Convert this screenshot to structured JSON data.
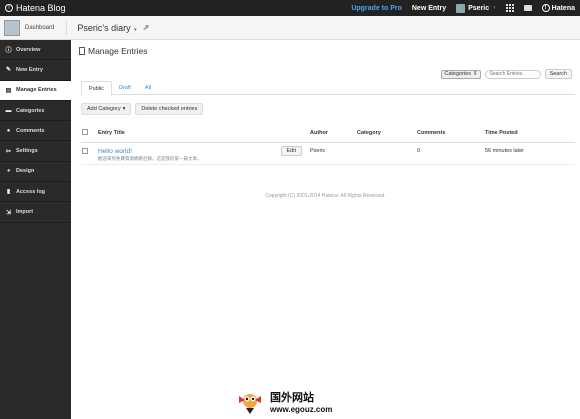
{
  "topbar": {
    "brand": "Hatena Blog",
    "upgrade": "Upgrade to Pro",
    "new_entry": "New Entry",
    "user": "Pseric",
    "brand_small": "Hatena"
  },
  "blogbar": {
    "dashboard": "Dashboard",
    "blog_name": "Pseric's diary"
  },
  "sidebar": {
    "items": [
      {
        "label": "Overview",
        "icon": "info-icon"
      },
      {
        "label": "New Entry",
        "icon": "pencil-icon"
      },
      {
        "label": "Manage Entries",
        "icon": "document-icon"
      },
      {
        "label": "Categories",
        "icon": "folder-icon"
      },
      {
        "label": "Comments",
        "icon": "comment-icon"
      },
      {
        "label": "Settings",
        "icon": "wrench-icon"
      },
      {
        "label": "Design",
        "icon": "palette-icon"
      },
      {
        "label": "Access log",
        "icon": "chart-icon"
      },
      {
        "label": "Import",
        "icon": "import-icon"
      }
    ]
  },
  "main": {
    "title": "Manage Entries",
    "category_select": "Categories",
    "search_placeholder": "Search Entries",
    "search_button": "Search",
    "tabs": [
      "Public",
      "Draft",
      "All"
    ],
    "add_category": "Add Category",
    "delete_checked": "Delete checked entries",
    "columns": [
      "Entry Title",
      "Author",
      "Category",
      "Comments",
      "Time Posted"
    ],
    "rows": [
      {
        "title": "Hello world!",
        "excerpt": "歡迎來到免費資源網路社群。這是我的第一篇文章。",
        "edit": "Edit",
        "author": "Pseric",
        "category": "",
        "comments": "0",
        "time": "56 minutes later"
      }
    ],
    "footer": "Copyright (C) 2001-2014 Hatena. All Rights Reserved."
  },
  "watermark": {
    "cn": "国外网站",
    "url": "www.egouz.com"
  },
  "colors": {
    "topbar_bg": "#222222",
    "sidebar_bg": "#2a2a2a",
    "link": "#3d8ccf",
    "upgrade": "#4aa3f0"
  }
}
